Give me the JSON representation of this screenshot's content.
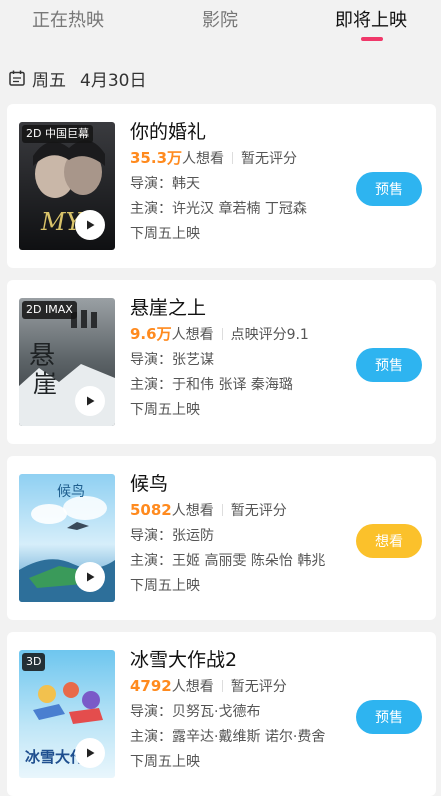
{
  "tabs": [
    {
      "label": "正在热映"
    },
    {
      "label": "影院"
    },
    {
      "label": "即将上映"
    }
  ],
  "date": {
    "weekday": "周五",
    "day": "4月30日"
  },
  "colors": {
    "accent": "#f0386a",
    "orange": "#ff8a1e",
    "blue_button": "#2eb4f0",
    "yellow_button": "#fbc12b"
  },
  "movies": [
    {
      "title": "你的婚礼",
      "format_tag": "2D 中国巨幕",
      "wish_count": "35.3万",
      "wish_suffix": "人想看",
      "rating": "暂无评分",
      "director": "导演：韩天",
      "cast": "主演：许光汉 章若楠 丁冠森",
      "release": "下周五上映",
      "button": "预售"
    },
    {
      "title": "悬崖之上",
      "format_tag": "2D IMAX",
      "wish_count": "9.6万",
      "wish_suffix": "人想看",
      "rating": "点映评分9.1",
      "director": "导演：张艺谋",
      "cast": "主演：于和伟 张译 秦海璐",
      "release": "下周五上映",
      "button": "预售"
    },
    {
      "title": "候鸟",
      "format_tag": "",
      "wish_count": "5082",
      "wish_suffix": "人想看",
      "rating": "暂无评分",
      "director": "导演：张运防",
      "cast": "主演：王姬 高丽雯 陈朵怡 韩兆",
      "release": "下周五上映",
      "button": "想看"
    },
    {
      "title": "冰雪大作战2",
      "format_tag": "3D",
      "wish_count": "4792",
      "wish_suffix": "人想看",
      "rating": "暂无评分",
      "director": "导演：贝努瓦·戈德布",
      "cast": "主演：露辛达·戴维斯 诺尔·费舍",
      "release": "下周五上映",
      "button": "预售"
    }
  ]
}
